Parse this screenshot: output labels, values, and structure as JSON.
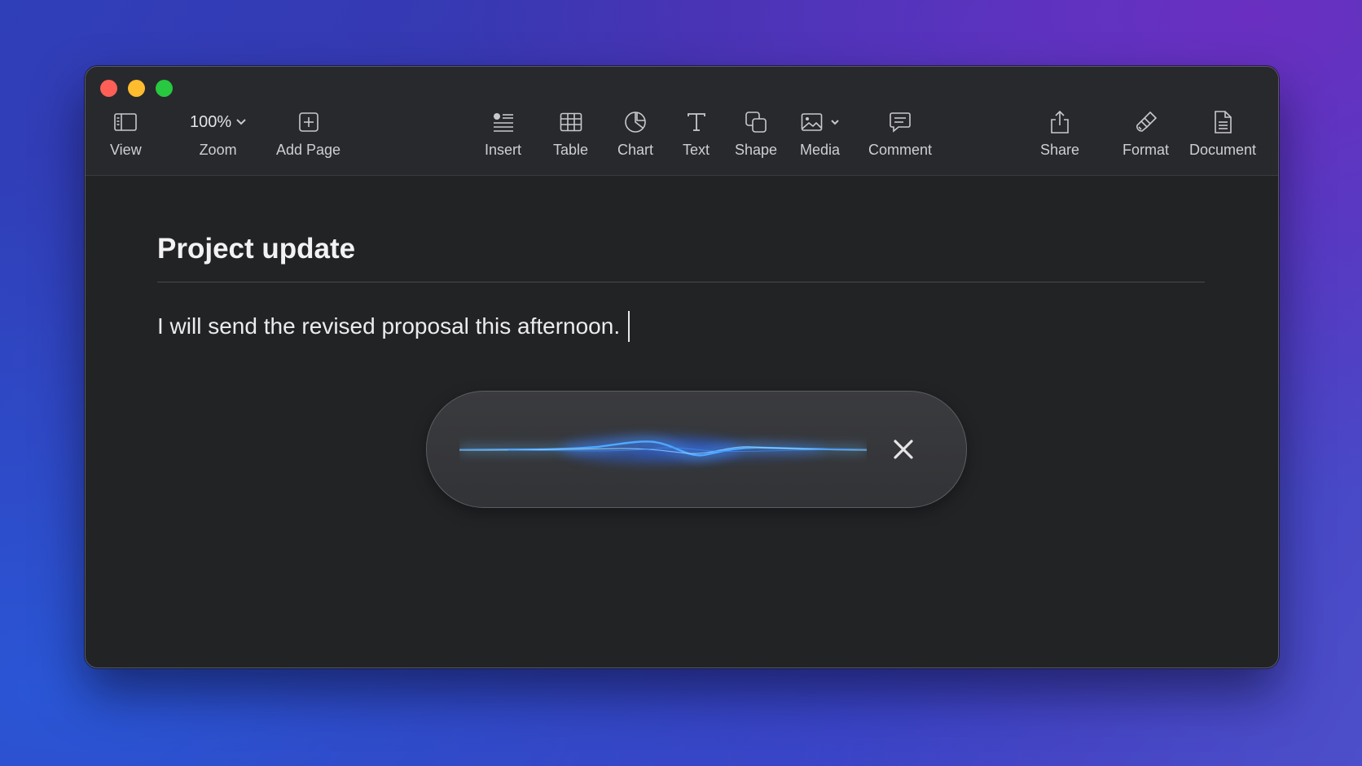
{
  "window": {
    "traffic_lights": [
      "close",
      "minimize",
      "zoom"
    ]
  },
  "toolbar": {
    "view_label": "View",
    "zoom_value": "100%",
    "zoom_label": "Zoom",
    "add_page_label": "Add Page",
    "insert_label": "Insert",
    "table_label": "Table",
    "chart_label": "Chart",
    "text_label": "Text",
    "shape_label": "Shape",
    "media_label": "Media",
    "comment_label": "Comment",
    "share_label": "Share",
    "format_label": "Format",
    "document_label": "Document"
  },
  "document": {
    "title": "Project update",
    "body": "I will send the revised proposal this afternoon."
  },
  "dictation": {
    "icon": "close-icon",
    "wave_color": "#4fa8ff"
  },
  "colors": {
    "window_bg": "#222325",
    "toolbar_bg": "#28292c",
    "accent_wave": "#4fa8ff"
  }
}
